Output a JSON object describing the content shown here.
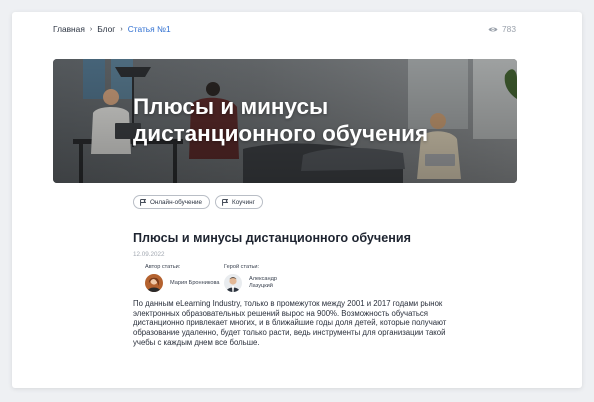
{
  "breadcrumbs": [
    {
      "label": "Главная"
    },
    {
      "label": "Блог"
    },
    {
      "label": "Статья №1"
    }
  ],
  "breadcrumb_separator": "›",
  "views": {
    "count": "783",
    "icon": "eye-icon"
  },
  "hero": {
    "title": "Плюсы и минусы дистанционного обучения"
  },
  "tags": [
    {
      "label": "Онлайн-обучение",
      "icon": "flag-icon"
    },
    {
      "label": "Коучинг",
      "icon": "flag-icon"
    }
  ],
  "article": {
    "title": "Плюсы и минусы дистанционного обучения",
    "date": "12.09.2022",
    "author": {
      "label": "Автор статьи:",
      "name": "Мария Бронникова"
    },
    "hero_person": {
      "label": "Герой статьи:",
      "name": "Александр Лазуцкий"
    },
    "body": "По данным eLearning Industry, только в промежуток между 2001 и 2017 годами рынок электронных образовательных решений вырос на 900%. Возможность обучаться дистанционно привлекает многих, и в ближайшие годы доля детей, которые получают образование удаленно, будет только расти, ведь инструменты для организации такой учебы с каждым днем все больше."
  },
  "colors": {
    "accent": "#2f6fd1",
    "muted": "#9aa1ab",
    "text": "#1e2430"
  }
}
